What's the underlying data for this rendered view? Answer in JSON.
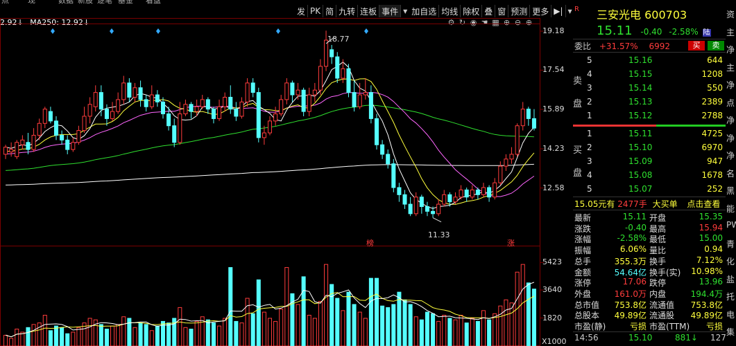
{
  "top_menu": [
    "点",
    "现",
    "数据",
    "新股",
    "逐笔",
    "基金",
    "看盘"
  ],
  "toolbar": [
    "发",
    "PK",
    "简",
    "九转",
    "连板",
    "事件",
    "加自选",
    "均线",
    "除权",
    "叠",
    "窗",
    "预测",
    "更多"
  ],
  "toolbar_extra": {
    "pin": "▶|",
    "caret": "▼"
  },
  "ma_legend": {
    "ma_partial": "2.92↓",
    "ma250": "MA250: 12.92↓"
  },
  "price_axis": [
    "19.18",
    "17.54",
    "15.89",
    "14.23",
    "12.58"
  ],
  "volume_axis": [
    "5423",
    "3640",
    "1820"
  ],
  "volume_unit": "X1000",
  "chart_labels": {
    "high": "18.77",
    "low": "11.33",
    "bang": "榜",
    "zhang": "涨"
  },
  "chart_tool_icons": [
    "settings-icon",
    "refresh-icon",
    "eye-icon",
    "hand-icon",
    "grid-icon",
    "plus-circle-icon",
    "minus-circle-icon",
    "zoom-in-icon"
  ],
  "quote": {
    "code_mark": "R",
    "name": "三安光电",
    "code": "600703",
    "price": "15.11",
    "change": "-0.40",
    "change_pct": "-2.58%",
    "tag": "陆",
    "weibi_label": "委比",
    "weibi_pct": "+31.57%",
    "weicha": "6992",
    "buy_btn": "买",
    "sell_btn": "卖"
  },
  "ask_label": [
    "卖",
    "盘"
  ],
  "bid_label": [
    "买",
    "盘"
  ],
  "asks": [
    {
      "level": "5",
      "price": "15.16",
      "vol": "644"
    },
    {
      "level": "4",
      "price": "15.15",
      "vol": "1208"
    },
    {
      "level": "3",
      "price": "15.14",
      "vol": "550"
    },
    {
      "level": "2",
      "price": "15.13",
      "vol": "2389"
    },
    {
      "level": "1",
      "price": "15.12",
      "vol": "2788"
    }
  ],
  "bids": [
    {
      "level": "1",
      "price": "15.11",
      "vol": "4725"
    },
    {
      "level": "2",
      "price": "15.10",
      "vol": "6970"
    },
    {
      "level": "3",
      "price": "15.09",
      "vol": "947"
    },
    {
      "level": "4",
      "price": "15.08",
      "vol": "1678"
    },
    {
      "level": "5",
      "price": "15.07",
      "vol": "252"
    }
  ],
  "big_order": {
    "price": "15.05元有",
    "volume": "2477手",
    "label": "大买单",
    "link": "点击查看"
  },
  "stats": [
    {
      "l1": "最新",
      "v1": "15.11",
      "c1": "#2fe02f",
      "l2": "开盘",
      "v2": "15.35",
      "c2": "#2fe02f"
    },
    {
      "l1": "涨跌",
      "v1": "-0.40",
      "c1": "#2fe02f",
      "l2": "最高",
      "v2": "15.94",
      "c2": "#ff3c3c"
    },
    {
      "l1": "涨幅",
      "v1": "-2.58%",
      "c1": "#2fe02f",
      "l2": "最低",
      "v2": "15.00",
      "c2": "#2fe02f"
    },
    {
      "l1": "振幅",
      "v1": "6.06%",
      "c1": "#ffff3c",
      "l2": "量比",
      "v2": "0.94",
      "c2": "#ffff3c"
    },
    {
      "l1": "总手",
      "v1": "355.3万",
      "c1": "#ffff3c",
      "l2": "换手",
      "v2": "7.12%",
      "c2": "#ffff3c"
    },
    {
      "l1": "金额",
      "v1": "54.64亿",
      "c1": "#5ff",
      "l2": "换手(实)",
      "v2": "10.98%",
      "c2": "#ffff3c"
    },
    {
      "l1": "涨停",
      "v1": "17.06",
      "c1": "#ff3c3c",
      "l2": "跌停",
      "v2": "13.96",
      "c2": "#2fe02f"
    },
    {
      "l1": "外盘",
      "v1": "161.0万",
      "c1": "#ff3c3c",
      "l2": "内盘",
      "v2": "194.4万",
      "c2": "#2fe02f"
    },
    {
      "l1": "总市值",
      "v1": "753.8亿",
      "c1": "#ffff3c",
      "l2": "流通值",
      "v2": "753.8亿",
      "c2": "#ffff3c"
    },
    {
      "l1": "总股本",
      "v1": "49.89亿",
      "c1": "#ffff3c",
      "l2": "流通股",
      "v2": "49.89亿",
      "c2": "#ffff3c"
    },
    {
      "l1": "市盈(静)",
      "v1": "亏损",
      "c1": "#ffff3c",
      "l2": "市盈(TTM)",
      "v2": "亏损",
      "c2": "#ffff3c"
    }
  ],
  "tick": {
    "time": "14:56",
    "price": "15.10",
    "vol": "881",
    "arrow": "↓",
    "count": "127"
  },
  "far_right": [
    "资",
    "主",
    "净",
    "主",
    "净",
    "点",
    "净",
    "净",
    "净",
    "名",
    "黑",
    "能",
    "PW",
    "青",
    "化",
    "盐",
    "托",
    "电",
    "集"
  ],
  "colors": {
    "up": "#ff3c3c",
    "down": "#5ff",
    "bg": "#000",
    "grid": "#7a0000",
    "ma5": "#ffffff",
    "ma10": "#ffff3c",
    "ma20": "#ff66ff",
    "ma60": "#2fe02f",
    "ma250": "#ffffff"
  },
  "chart_data": {
    "type": "candlestick",
    "ylim": [
      11.0,
      19.5
    ],
    "candles": [
      [
        14.0,
        14.3,
        13.8,
        14.4
      ],
      [
        14.1,
        14.2,
        13.9,
        14.5
      ],
      [
        13.9,
        14.5,
        13.8,
        14.6
      ],
      [
        14.4,
        14.6,
        14.2,
        14.8
      ],
      [
        14.5,
        14.2,
        14.0,
        14.9
      ],
      [
        14.2,
        14.8,
        14.1,
        15.1
      ],
      [
        14.8,
        15.3,
        14.6,
        15.5
      ],
      [
        15.3,
        15.9,
        15.1,
        16.0
      ],
      [
        15.8,
        15.4,
        15.3,
        16.0
      ],
      [
        15.4,
        14.8,
        14.6,
        15.6
      ],
      [
        14.8,
        14.6,
        14.4,
        15.0
      ],
      [
        14.6,
        14.2,
        14.0,
        14.8
      ],
      [
        14.2,
        14.5,
        14.1,
        14.7
      ],
      [
        14.5,
        15.0,
        14.4,
        15.2
      ],
      [
        15.0,
        15.6,
        14.9,
        16.0
      ],
      [
        15.6,
        16.1,
        15.3,
        16.4
      ],
      [
        16.0,
        16.6,
        15.8,
        16.9
      ],
      [
        16.6,
        15.9,
        15.6,
        16.9
      ],
      [
        15.9,
        15.5,
        15.2,
        16.1
      ],
      [
        15.5,
        15.8,
        15.4,
        16.2
      ],
      [
        15.8,
        16.3,
        15.7,
        16.6
      ],
      [
        16.3,
        17.0,
        16.1,
        17.3
      ],
      [
        17.0,
        16.4,
        16.2,
        17.2
      ],
      [
        16.4,
        16.8,
        16.2,
        17.0
      ],
      [
        16.8,
        16.3,
        16.0,
        17.1
      ],
      [
        16.3,
        16.0,
        15.8,
        16.5
      ],
      [
        16.0,
        16.5,
        15.9,
        16.9
      ],
      [
        16.5,
        16.2,
        16.0,
        16.7
      ],
      [
        16.2,
        15.7,
        15.5,
        16.4
      ],
      [
        15.7,
        15.2,
        15.0,
        16.0
      ],
      [
        15.2,
        14.5,
        14.3,
        15.5
      ],
      [
        14.5,
        15.7,
        14.4,
        16.2
      ],
      [
        15.7,
        16.1,
        15.6,
        16.3
      ],
      [
        16.1,
        15.8,
        15.5,
        16.2
      ],
      [
        15.8,
        16.0,
        15.6,
        16.3
      ],
      [
        16.0,
        16.3,
        15.9,
        16.5
      ],
      [
        16.3,
        15.9,
        15.7,
        16.4
      ],
      [
        15.9,
        15.5,
        15.3,
        16.0
      ],
      [
        15.5,
        16.0,
        15.4,
        16.3
      ],
      [
        16.0,
        16.4,
        15.8,
        16.6
      ],
      [
        16.4,
        15.9,
        15.7,
        16.9
      ],
      [
        15.9,
        15.6,
        15.4,
        16.2
      ],
      [
        15.6,
        16.2,
        15.5,
        16.4
      ],
      [
        16.2,
        17.0,
        16.0,
        17.2
      ],
      [
        17.0,
        16.6,
        16.4,
        17.2
      ],
      [
        16.6,
        14.7,
        14.5,
        16.8
      ],
      [
        14.7,
        14.9,
        14.4,
        15.2
      ],
      [
        14.9,
        15.4,
        14.8,
        15.6
      ],
      [
        15.4,
        15.7,
        15.2,
        16.0
      ],
      [
        15.7,
        16.3,
        15.6,
        16.5
      ],
      [
        16.3,
        17.0,
        16.1,
        17.2
      ],
      [
        17.0,
        16.5,
        16.2,
        17.1
      ],
      [
        16.5,
        16.7,
        16.3,
        17.0
      ],
      [
        16.7,
        15.8,
        15.6,
        16.8
      ],
      [
        15.8,
        16.5,
        15.6,
        16.8
      ],
      [
        16.5,
        16.7,
        16.2,
        17.0
      ],
      [
        16.7,
        17.7,
        16.5,
        18.0
      ],
      [
        17.7,
        18.8,
        17.5,
        19.2
      ],
      [
        18.4,
        18.1,
        17.8,
        18.6
      ],
      [
        18.1,
        17.2,
        17.0,
        18.3
      ],
      [
        17.2,
        17.6,
        17.0,
        18.0
      ],
      [
        17.6,
        16.6,
        16.4,
        17.8
      ],
      [
        16.6,
        16.0,
        15.8,
        17.1
      ],
      [
        16.0,
        16.5,
        15.9,
        17.0
      ],
      [
        16.5,
        16.6,
        16.3,
        17.2
      ],
      [
        16.6,
        15.5,
        15.3,
        16.9
      ],
      [
        15.5,
        14.4,
        14.2,
        15.7
      ],
      [
        14.4,
        14.0,
        13.8,
        14.6
      ],
      [
        14.0,
        13.6,
        13.4,
        14.2
      ],
      [
        13.6,
        12.6,
        12.4,
        13.8
      ],
      [
        12.6,
        12.3,
        12.0,
        12.8
      ],
      [
        12.3,
        11.9,
        11.7,
        12.5
      ],
      [
        11.9,
        11.5,
        11.4,
        12.2
      ],
      [
        11.5,
        12.2,
        11.4,
        12.4
      ],
      [
        12.2,
        11.8,
        11.5,
        12.3
      ],
      [
        11.8,
        11.6,
        11.4,
        12.0
      ],
      [
        11.6,
        11.5,
        11.33,
        11.8
      ],
      [
        11.5,
        11.9,
        11.4,
        12.1
      ],
      [
        11.9,
        12.3,
        11.8,
        12.5
      ],
      [
        12.3,
        12.0,
        11.8,
        12.4
      ],
      [
        12.0,
        12.2,
        11.9,
        12.4
      ],
      [
        12.2,
        12.5,
        12.1,
        12.7
      ],
      [
        12.5,
        12.2,
        12.0,
        12.6
      ],
      [
        12.2,
        12.5,
        12.1,
        12.7
      ],
      [
        12.5,
        12.3,
        12.1,
        12.6
      ],
      [
        12.3,
        12.6,
        12.2,
        12.8
      ],
      [
        12.6,
        12.2,
        12.0,
        12.7
      ],
      [
        12.2,
        12.8,
        12.1,
        13.0
      ],
      [
        12.8,
        13.5,
        12.7,
        13.7
      ],
      [
        13.5,
        13.8,
        13.3,
        14.0
      ],
      [
        13.8,
        14.0,
        13.6,
        14.3
      ],
      [
        14.0,
        15.2,
        13.9,
        15.3
      ],
      [
        15.2,
        15.9,
        15.0,
        16.2
      ],
      [
        15.9,
        15.5,
        15.2,
        16.0
      ],
      [
        15.5,
        15.1,
        15.0,
        15.9
      ]
    ],
    "volumes": [
      700,
      500,
      1100,
      900,
      1200,
      1400,
      1500,
      2000,
      1000,
      1300,
      1200,
      800,
      900,
      1200,
      1500,
      1800,
      1700,
      1400,
      1100,
      1300,
      1400,
      1900,
      1800,
      1200,
      1500,
      1400,
      1000,
      1300,
      1600,
      1500,
      1800,
      2500,
      1200,
      1100,
      1600,
      1900,
      1700,
      1500,
      1300,
      1800,
      5100,
      1600,
      1500,
      3100,
      2100,
      4300,
      2200,
      1800,
      1600,
      2400,
      5100,
      3400,
      2700,
      4500,
      2000,
      1800,
      2900,
      5300,
      4000,
      3100,
      2300,
      3500,
      2700,
      2200,
      1800,
      4400,
      4400,
      2600,
      2500,
      2700,
      3500,
      3000,
      2700,
      1900,
      1700,
      2200,
      2100,
      1600,
      2000,
      1800,
      1700,
      2000,
      1500,
      1800,
      1600,
      2300,
      1700,
      2100,
      2600,
      3000,
      2800,
      4800,
      5300,
      4100,
      3700
    ]
  }
}
